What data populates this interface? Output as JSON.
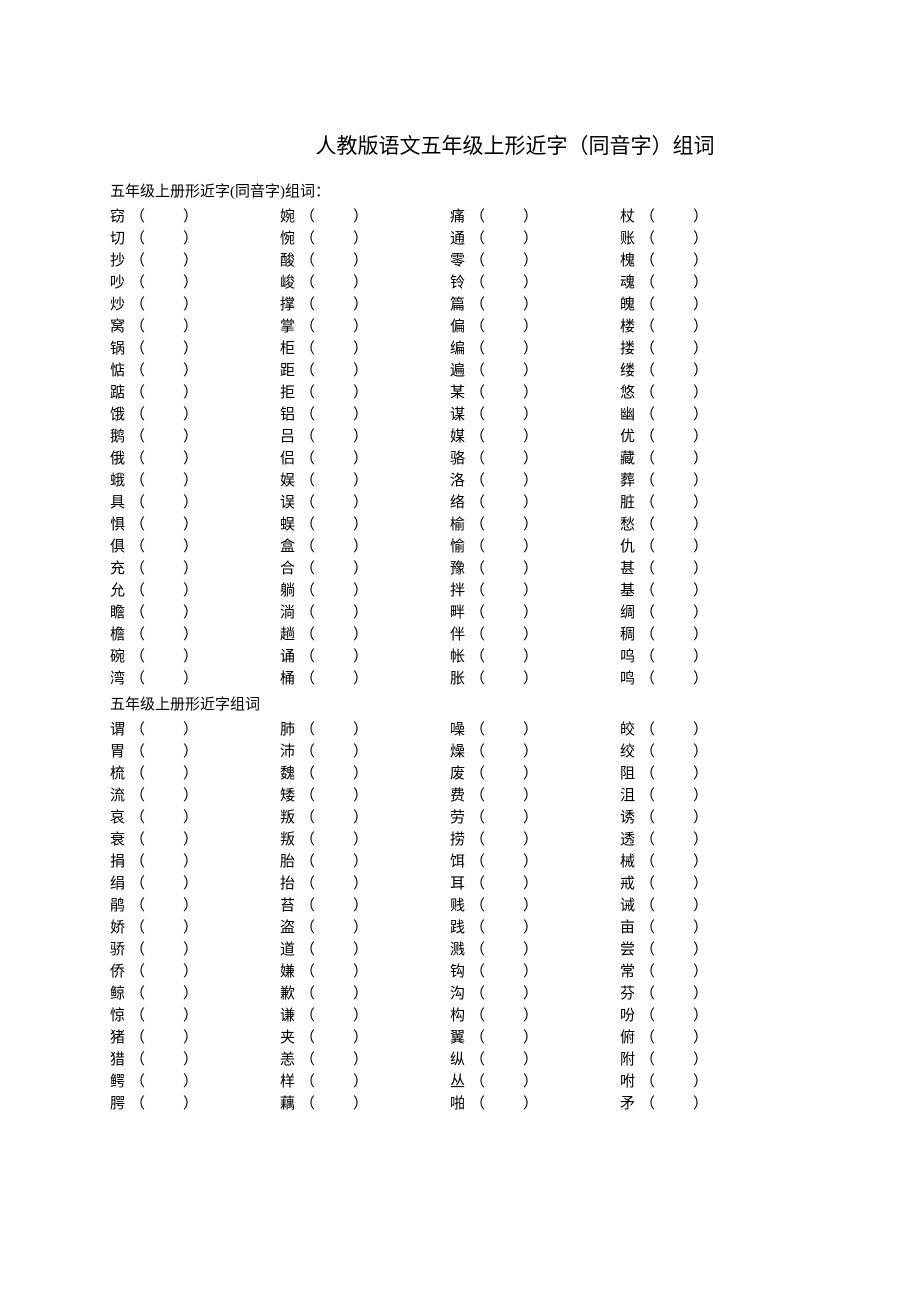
{
  "title": "人教版语文五年级上形近字（同音字）组词",
  "section1_heading": "五年级上册形近字(同音字)组词：",
  "section2_heading": "五年级上册形近字组词",
  "paren_open": "（",
  "paren_close": "）",
  "section1": [
    [
      "窃",
      "婉",
      "痛",
      "杖"
    ],
    [
      "切",
      "惋",
      "通",
      "账"
    ],
    [
      "抄",
      "酸",
      "零",
      "槐"
    ],
    [
      "吵",
      "峻",
      "铃",
      "魂"
    ],
    [
      "炒",
      "撑",
      "篇",
      "魄"
    ],
    [
      "窝",
      "掌",
      "偏",
      "楼"
    ],
    [
      "锅",
      "柜",
      "编",
      "搂"
    ],
    [
      "惦",
      "距",
      "遍",
      "缕"
    ],
    [
      "踮",
      "拒",
      "某",
      "悠"
    ],
    [
      "饿",
      "铝",
      "谋",
      "幽"
    ],
    [
      "鹅",
      "吕",
      "媒",
      "优"
    ],
    [
      "俄",
      "侣",
      "骆",
      "藏"
    ],
    [
      "蛾",
      "娱",
      "洛",
      "葬"
    ],
    [
      "具",
      "误",
      "络",
      "脏"
    ],
    [
      "惧",
      "蜈",
      "榆",
      "愁"
    ],
    [
      "俱",
      "盒",
      "愉",
      "仇"
    ],
    [
      "充",
      "合",
      "豫",
      "甚"
    ],
    [
      "允",
      "躺",
      "拌",
      "基"
    ],
    [
      "瞻",
      "淌",
      "畔",
      "绸"
    ],
    [
      "檐",
      "趟",
      "伴",
      "稠"
    ],
    [
      "碗",
      "诵",
      "帐",
      "呜"
    ],
    [
      "湾",
      "桶",
      "胀",
      "鸣"
    ]
  ],
  "section2": [
    [
      "谓",
      "肺",
      "噪",
      "皎"
    ],
    [
      "胃",
      "沛",
      "燥",
      "绞"
    ],
    [
      "梳",
      "魏",
      "废",
      "阻"
    ],
    [
      "流",
      "矮",
      "费",
      "沮"
    ],
    [
      "哀",
      "叛",
      "劳",
      "诱"
    ],
    [
      "衰",
      "叛",
      "捞",
      "透"
    ],
    [
      "捐",
      "胎",
      "饵",
      "械"
    ],
    [
      "绢",
      "抬",
      "耳",
      "戒"
    ],
    [
      "鹃",
      "苔",
      "贱",
      "诫"
    ],
    [
      "娇",
      "盗",
      "践",
      "亩"
    ],
    [
      "骄",
      "道",
      "溅",
      "尝"
    ],
    [
      "侨",
      "嫌",
      "钩",
      "常"
    ],
    [
      "鲸",
      "歉",
      "沟",
      "芬"
    ],
    [
      "惊",
      "谦",
      "构",
      "吩"
    ],
    [
      "猪",
      "夹",
      "翼",
      "俯"
    ],
    [
      "猎",
      "恙",
      "纵",
      "附"
    ],
    [
      "鳄",
      "样",
      "丛",
      "咐"
    ],
    [
      "腭",
      "藕",
      "啪",
      "矛"
    ]
  ]
}
